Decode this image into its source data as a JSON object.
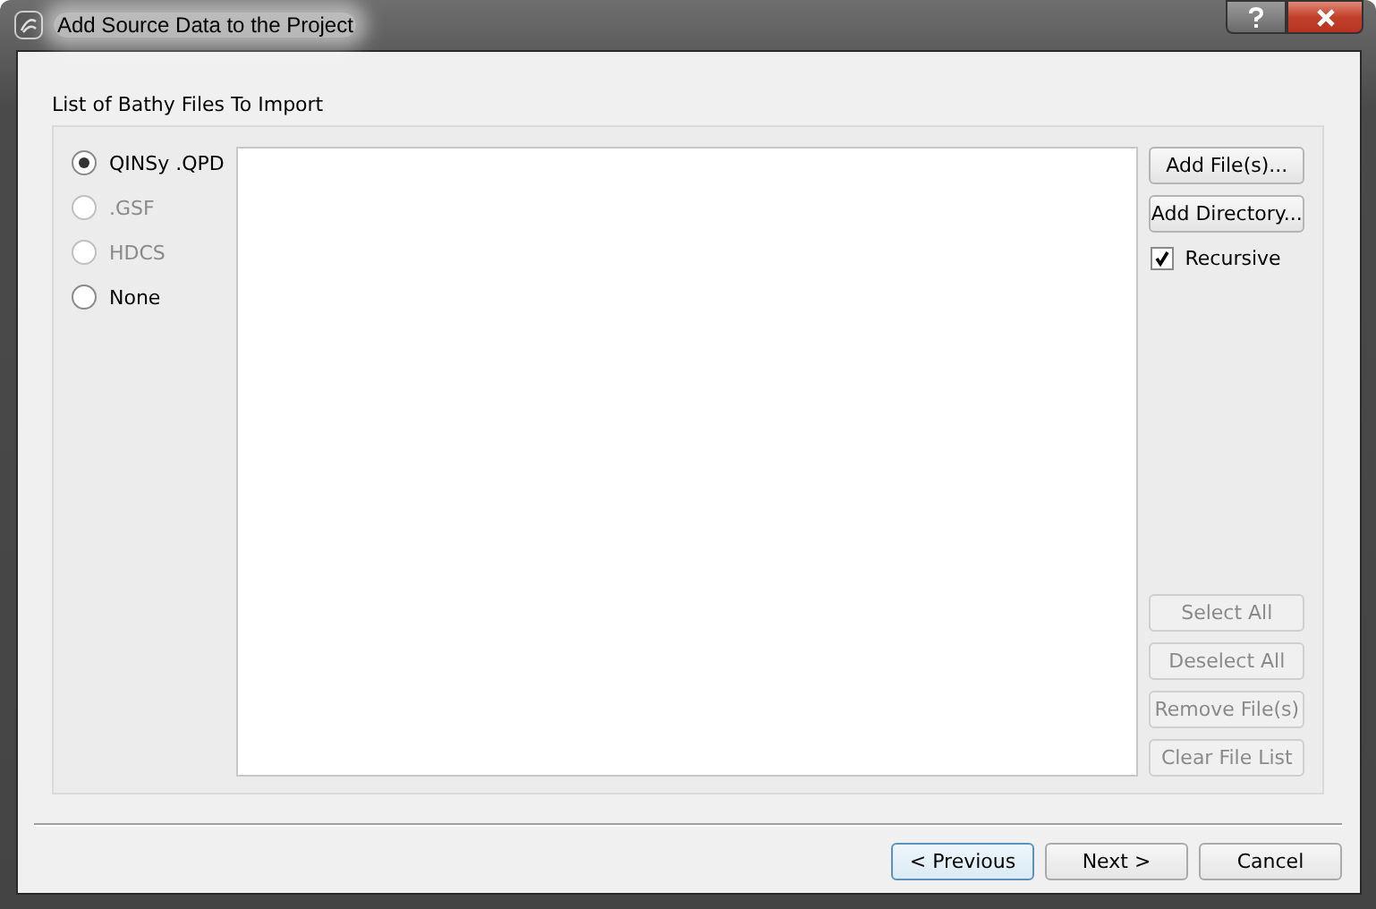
{
  "window": {
    "title": "Add Source Data to the Project"
  },
  "group": {
    "label": "List of Bathy Files To Import"
  },
  "formats": [
    {
      "label": "QINSy .QPD",
      "selected": true,
      "disabled": false
    },
    {
      "label": ".GSF",
      "selected": false,
      "disabled": true
    },
    {
      "label": "HDCS",
      "selected": false,
      "disabled": true
    },
    {
      "label": "None",
      "selected": false,
      "disabled": false
    }
  ],
  "top_buttons": [
    {
      "label": "Add File(s)...",
      "disabled": false
    },
    {
      "label": "Add Directory...",
      "disabled": false
    }
  ],
  "recursive": {
    "label": "Recursive",
    "checked": true
  },
  "bottom_buttons": [
    {
      "label": "Select All",
      "disabled": true
    },
    {
      "label": "Deselect All",
      "disabled": true
    },
    {
      "label": "Remove File(s)",
      "disabled": true
    },
    {
      "label": "Clear File List",
      "disabled": true
    }
  ],
  "footer_buttons": [
    {
      "label": "< Previous",
      "focused": true
    },
    {
      "label": "Next >",
      "focused": false
    },
    {
      "label": "Cancel",
      "focused": false
    }
  ]
}
